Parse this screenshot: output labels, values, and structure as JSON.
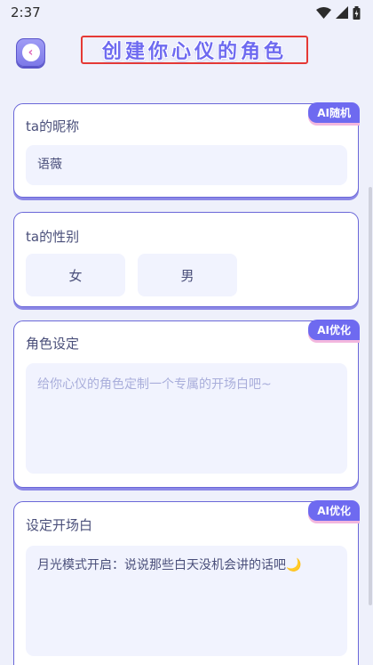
{
  "status_bar": {
    "time": "2:37"
  },
  "header": {
    "title": "创建你心仪的角色"
  },
  "nickname": {
    "label": "ta的昵称",
    "ai_label": "AI随机",
    "value": "语薇"
  },
  "gender": {
    "label": "ta的性别",
    "options": [
      "女",
      "男"
    ]
  },
  "role_setting": {
    "label": "角色设定",
    "ai_label": "AI优化",
    "placeholder": "给你心仪的角色定制一个专属的开场白吧~"
  },
  "opening": {
    "label": "设定开场白",
    "ai_label": "AI优化",
    "value": "月光模式开启：说说那些白天没机会讲的话吧🌙"
  },
  "colors": {
    "accent": "#6e6af0",
    "field_bg": "#f1f3fe",
    "page_bg": "#eef0fb"
  }
}
